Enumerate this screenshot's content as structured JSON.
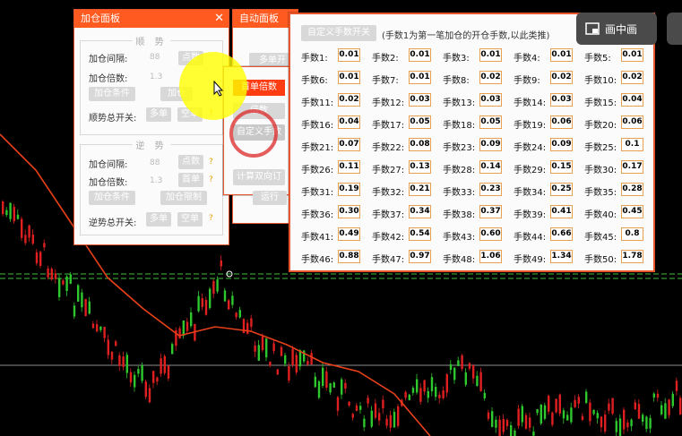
{
  "colors": {
    "accent": "#ff5a1f",
    "candle_up": "#2ec82e",
    "candle_down": "#e02020",
    "ma_line": "#e8401a",
    "grid_line": "#3fbf3f"
  },
  "add_panel": {
    "title": "加仓面板",
    "trend": {
      "title": "顺 势",
      "interval_label": "加仓间隔:",
      "interval_value": "88",
      "interval_unit": "点数",
      "multiplier_label": "加仓倍数:",
      "multiplier_value": "1.3",
      "condition_button": "加仓条件",
      "limit_button": "加仓",
      "switch_label": "顺势总开关:",
      "buy_button": "多单",
      "sell_button": "空单"
    },
    "counter": {
      "title": "逆 势",
      "interval_label": "加仓间隔:",
      "interval_value": "88",
      "interval_unit": "点数",
      "multiplier_label": "加仓倍数:",
      "multiplier_value": "1.3",
      "multiplier_unit": "首单",
      "condition_button": "加仓条件",
      "limit_button": "加仓限制",
      "switch_label": "逆势总开关:",
      "buy_button": "多单",
      "sell_button": "空单"
    },
    "question_mark": "?"
  },
  "auto_panel": {
    "title": "自动面板",
    "multi_button": "多单开",
    "single_multiplier_button": "首单倍数",
    "multiplier_button": "倍数",
    "custom_button": "自定义手数",
    "calc_button": "计算双向订",
    "run_button": "运行"
  },
  "lots_panel": {
    "toggle_button": "自定义手数开关",
    "note": "(手数1为第一笔加仓的开仓手数,以此类推)",
    "lots": [
      {
        "label": "手数1:",
        "value": "0.01"
      },
      {
        "label": "手数2:",
        "value": "0.01"
      },
      {
        "label": "手数3:",
        "value": "0.01"
      },
      {
        "label": "手数4:",
        "value": "0.01"
      },
      {
        "label": "手数5:",
        "value": "0.01"
      },
      {
        "label": "手数6:",
        "value": "0.01"
      },
      {
        "label": "手数7:",
        "value": "0.01"
      },
      {
        "label": "手数8:",
        "value": "0.02"
      },
      {
        "label": "手数9:",
        "value": "0.02"
      },
      {
        "label": "手数10:",
        "value": "0.02"
      },
      {
        "label": "手数11:",
        "value": "0.02"
      },
      {
        "label": "手数12:",
        "value": "0.03"
      },
      {
        "label": "手数13:",
        "value": "0.03"
      },
      {
        "label": "手数14:",
        "value": "0.03"
      },
      {
        "label": "手数15:",
        "value": "0.04"
      },
      {
        "label": "手数16:",
        "value": "0.04"
      },
      {
        "label": "手数17:",
        "value": "0.05"
      },
      {
        "label": "手数18:",
        "value": "0.05"
      },
      {
        "label": "手数19:",
        "value": "0.06"
      },
      {
        "label": "手数20:",
        "value": "0.06"
      },
      {
        "label": "手数21:",
        "value": "0.07"
      },
      {
        "label": "手数22:",
        "value": "0.08"
      },
      {
        "label": "手数23:",
        "value": "0.09"
      },
      {
        "label": "手数24:",
        "value": "0.09"
      },
      {
        "label": "手数25:",
        "value": "0.1"
      },
      {
        "label": "手数26:",
        "value": "0.11"
      },
      {
        "label": "手数27:",
        "value": "0.13"
      },
      {
        "label": "手数28:",
        "value": "0.14"
      },
      {
        "label": "手数29:",
        "value": "0.15"
      },
      {
        "label": "手数30:",
        "value": "0.17"
      },
      {
        "label": "手数31:",
        "value": "0.19"
      },
      {
        "label": "手数32:",
        "value": "0.21"
      },
      {
        "label": "手数33:",
        "value": "0.23"
      },
      {
        "label": "手数34:",
        "value": "0.25"
      },
      {
        "label": "手数35:",
        "value": "0.28"
      },
      {
        "label": "手数36:",
        "value": "0.30"
      },
      {
        "label": "手数37:",
        "value": "0.34"
      },
      {
        "label": "手数38:",
        "value": "0.37"
      },
      {
        "label": "手数39:",
        "value": "0.41"
      },
      {
        "label": "手数40:",
        "value": "0.45"
      },
      {
        "label": "手数41:",
        "value": "0.49"
      },
      {
        "label": "手数42:",
        "value": "0.54"
      },
      {
        "label": "手数43:",
        "value": "0.60"
      },
      {
        "label": "手数44:",
        "value": "0.66"
      },
      {
        "label": "手数45:",
        "value": "0.8"
      },
      {
        "label": "手数46:",
        "value": "0.88"
      },
      {
        "label": "手数47:",
        "value": "0.97"
      },
      {
        "label": "手数48:",
        "value": "1.06"
      },
      {
        "label": "手数49:",
        "value": "1.34"
      },
      {
        "label": "手数50:",
        "value": "1.78"
      }
    ]
  },
  "pip_button": {
    "label": "画中画",
    "icon": "picture-in-picture-icon"
  }
}
